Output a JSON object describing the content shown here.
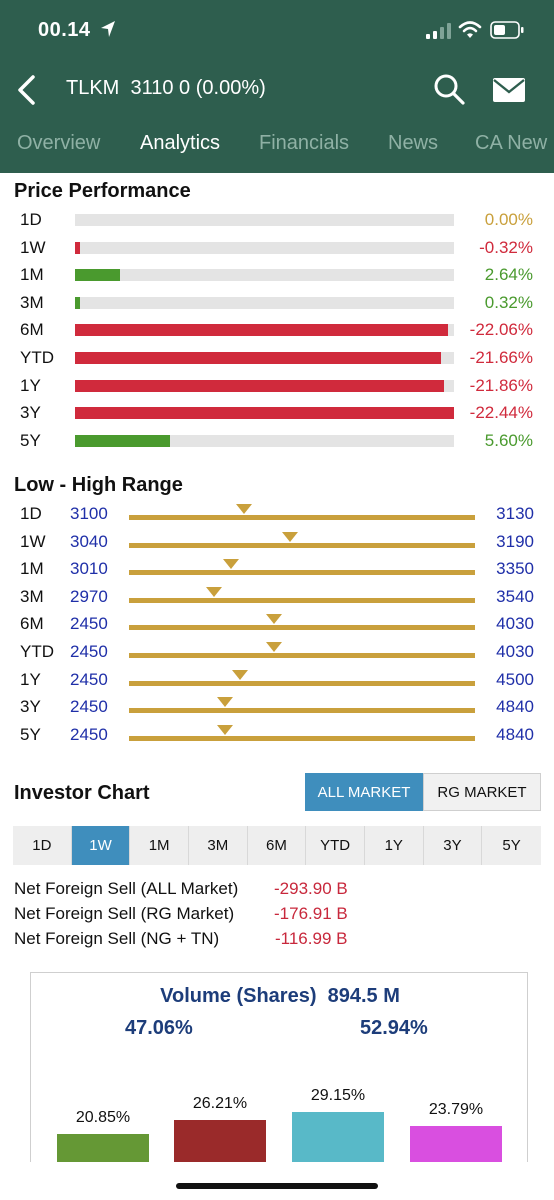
{
  "status_bar": {
    "time": "00.14"
  },
  "nav": {
    "ticker": "TLKM",
    "price": "3110",
    "change": "0 (0.00%)"
  },
  "tabs": [
    {
      "label": "Overview",
      "active": false
    },
    {
      "label": "Analytics",
      "active": true
    },
    {
      "label": "Financials",
      "active": false
    },
    {
      "label": "News",
      "active": false
    },
    {
      "label": "CA New",
      "active": false
    }
  ],
  "price_performance": {
    "title": "Price Performance",
    "colors": {
      "positive": "#4a9a2e",
      "negative": "#d02a3c",
      "neutral": "#c9a03c"
    },
    "rows": [
      {
        "label": "1D",
        "value": "0.00%",
        "pct": 0.0
      },
      {
        "label": "1W",
        "value": "-0.32%",
        "pct": -0.32
      },
      {
        "label": "1M",
        "value": "2.64%",
        "pct": 2.64
      },
      {
        "label": "3M",
        "value": "0.32%",
        "pct": 0.32
      },
      {
        "label": "6M",
        "value": "-22.06%",
        "pct": -22.06
      },
      {
        "label": "YTD",
        "value": "-21.66%",
        "pct": -21.66
      },
      {
        "label": "1Y",
        "value": "-21.86%",
        "pct": -21.86
      },
      {
        "label": "3Y",
        "value": "-22.44%",
        "pct": -22.44
      },
      {
        "label": "5Y",
        "value": "5.60%",
        "pct": 5.6
      }
    ]
  },
  "low_high_range": {
    "title": "Low - High Range",
    "current_price": 3110,
    "rows": [
      {
        "label": "1D",
        "low": "3100",
        "high": "3130"
      },
      {
        "label": "1W",
        "low": "3040",
        "high": "3190"
      },
      {
        "label": "1M",
        "low": "3010",
        "high": "3350"
      },
      {
        "label": "3M",
        "low": "2970",
        "high": "3540"
      },
      {
        "label": "6M",
        "low": "2450",
        "high": "4030"
      },
      {
        "label": "YTD",
        "low": "2450",
        "high": "4030"
      },
      {
        "label": "1Y",
        "low": "2450",
        "high": "4500"
      },
      {
        "label": "3Y",
        "low": "2450",
        "high": "4840"
      },
      {
        "label": "5Y",
        "low": "2450",
        "high": "4840"
      }
    ]
  },
  "investor_chart": {
    "title": "Investor Chart",
    "market_buttons": [
      {
        "label": "ALL MARKET",
        "active": true
      },
      {
        "label": "RG MARKET",
        "active": false
      }
    ],
    "periods": [
      {
        "label": "1D",
        "active": false
      },
      {
        "label": "1W",
        "active": true
      },
      {
        "label": "1M",
        "active": false
      },
      {
        "label": "3M",
        "active": false
      },
      {
        "label": "6M",
        "active": false
      },
      {
        "label": "YTD",
        "active": false
      },
      {
        "label": "1Y",
        "active": false
      },
      {
        "label": "3Y",
        "active": false
      },
      {
        "label": "5Y",
        "active": false
      }
    ],
    "net_foreign": [
      {
        "label": "Net Foreign Sell (ALL Market)",
        "value": "-293.90 B"
      },
      {
        "label": "Net Foreign Sell (RG Market)",
        "value": "-176.91 B"
      },
      {
        "label": "Net Foreign Sell (NG + TN)",
        "value": "-116.99 B"
      }
    ]
  },
  "volume": {
    "title": "Volume (Shares)  894.5 M",
    "left_pct": "47.06%",
    "right_pct": "52.94%"
  },
  "chart_data": {
    "type": "bar",
    "title": "Volume (Shares)  894.5 M",
    "categories": [
      "",
      "",
      "",
      ""
    ],
    "values": [
      20.85,
      26.21,
      29.15,
      23.79
    ],
    "value_labels": [
      "20.85%",
      "26.21%",
      "29.15%",
      "23.79%"
    ],
    "colors": [
      "#659835",
      "#9a2a2a",
      "#58b9c8",
      "#d94fe0"
    ],
    "ylim": [
      0,
      30
    ]
  }
}
